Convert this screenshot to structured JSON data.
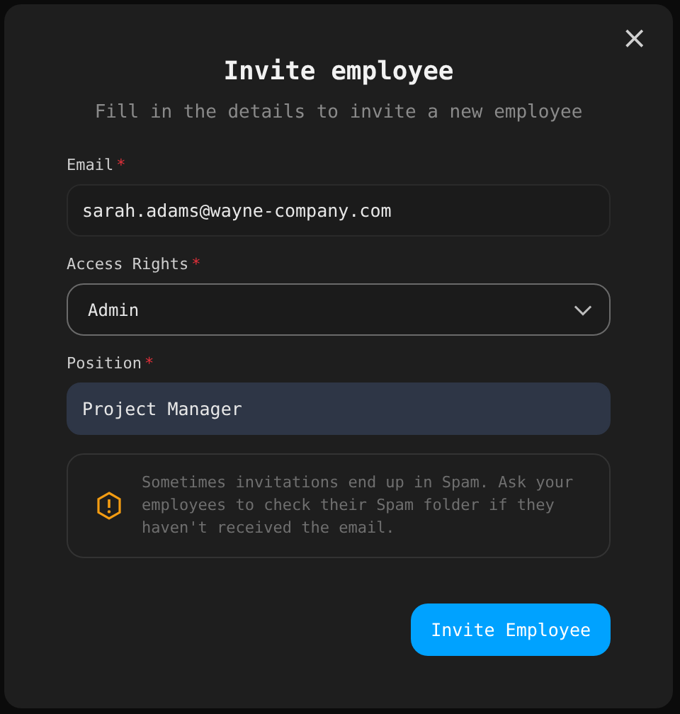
{
  "dialog": {
    "title": "Invite employee",
    "subtitle": "Fill in the details to invite a new employee",
    "close": "×"
  },
  "fields": [
    {
      "kind": "text",
      "label": "Email",
      "required_mark": "*",
      "value": "sarah.adams@wayne-company.com",
      "highlighted": false
    },
    {
      "kind": "select",
      "label": "Access Rights",
      "required_mark": "*",
      "value": "Admin",
      "highlighted": false
    },
    {
      "kind": "text",
      "label": "Position",
      "required_mark": "*",
      "value": "Project Manager",
      "highlighted": true
    }
  ],
  "notice": {
    "text": "Sometimes invitations end up in Spam. Ask your employees to check their Spam folder if they haven't received the email."
  },
  "buttons": [
    {
      "label": "Invite Employee",
      "kind": "primary"
    }
  ]
}
